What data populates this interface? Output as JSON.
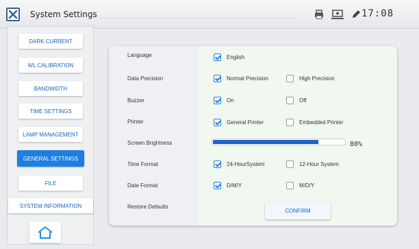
{
  "window": {
    "title": "System Settings",
    "time": "17:08"
  },
  "status_icons": [
    "printer-icon",
    "monitor-icon",
    "pencil-icon"
  ],
  "sidebar": {
    "items": [
      {
        "label": "DARK CURRENT",
        "active": false
      },
      {
        "label": "WL CALIBRATION",
        "active": false
      },
      {
        "label": "BANDWIDTH",
        "active": false
      },
      {
        "label": "TIME SETTINGS",
        "active": false
      },
      {
        "label": "LAMP MANAGEMENT",
        "active": false
      },
      {
        "label": "GENERAL SETTINGS",
        "active": true
      },
      {
        "label": "FILE",
        "active": false
      },
      {
        "label": "SYSTEM INFORMATION",
        "active": false
      }
    ],
    "home_icon": "home-icon"
  },
  "settings": {
    "language": {
      "label": "Language",
      "options": [
        {
          "text": "English",
          "checked": true
        }
      ]
    },
    "precision": {
      "label": "Data Precision",
      "options": [
        {
          "text": "Normal Precision",
          "checked": true
        },
        {
          "text": "High Precision",
          "checked": false
        }
      ]
    },
    "buzzer": {
      "label": "Buzzer",
      "options": [
        {
          "text": "On",
          "checked": true
        },
        {
          "text": "Off",
          "checked": false
        }
      ]
    },
    "printer": {
      "label": "Printer",
      "options": [
        {
          "text": "General Printer",
          "checked": true
        },
        {
          "text": "Embedded Printer",
          "checked": false
        }
      ]
    },
    "brightness": {
      "label": "Screen Brightness",
      "value": "80%",
      "fraction": 0.8
    },
    "time_format": {
      "label": "Time Format",
      "options": [
        {
          "text": "24-HourSystem",
          "checked": true
        },
        {
          "text": "12-Hour System",
          "checked": false
        }
      ]
    },
    "date_format": {
      "label": "Date Format",
      "options": [
        {
          "text": "D/M/Y",
          "checked": true
        },
        {
          "text": "M/D/Y",
          "checked": false
        }
      ]
    },
    "restore": {
      "label": "Restore Defaults",
      "button": "CONFIRM"
    }
  },
  "colors": {
    "accent": "#1e7fe0",
    "brightness_fill": "#1e62c8",
    "panel_right": "#f1f8ef"
  }
}
